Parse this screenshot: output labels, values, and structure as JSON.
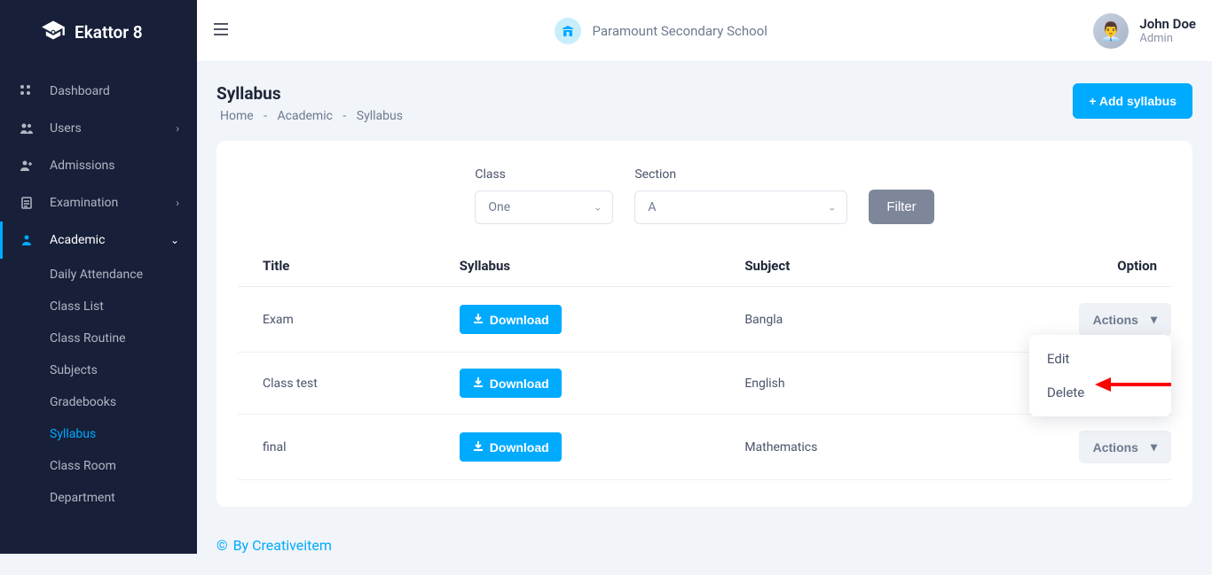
{
  "brand": {
    "name": "Ekattor 8"
  },
  "school": {
    "name": "Paramount Secondary School"
  },
  "user": {
    "name": "John Doe",
    "role": "Admin"
  },
  "nav": {
    "dashboard": "Dashboard",
    "users": "Users",
    "admissions": "Admissions",
    "examination": "Examination",
    "academic": "Academic"
  },
  "subnav": {
    "daily_attendance": "Daily Attendance",
    "class_list": "Class List",
    "class_routine": "Class Routine",
    "subjects": "Subjects",
    "gradebooks": "Gradebooks",
    "syllabus": "Syllabus",
    "class_room": "Class Room",
    "department": "Department"
  },
  "page": {
    "title": "Syllabus",
    "breadcrumb": {
      "home": "Home",
      "mid": "Academic",
      "leaf": "Syllabus"
    },
    "add_button": "+ Add syllabus"
  },
  "filters": {
    "class_label": "Class",
    "section_label": "Section",
    "class_value": "One",
    "section_value": "A",
    "filter_button": "Filter"
  },
  "table": {
    "headers": {
      "title": "Title",
      "syllabus": "Syllabus",
      "subject": "Subject",
      "option": "Option"
    },
    "download_label": "Download",
    "actions_label": "Actions",
    "rows": [
      {
        "title": "Exam",
        "subject": "Bangla"
      },
      {
        "title": "Class test",
        "subject": "English"
      },
      {
        "title": "final",
        "subject": "Mathematics"
      }
    ]
  },
  "dropdown": {
    "edit": "Edit",
    "delete": "Delete"
  },
  "footer": {
    "text": "By Creativeitem"
  }
}
